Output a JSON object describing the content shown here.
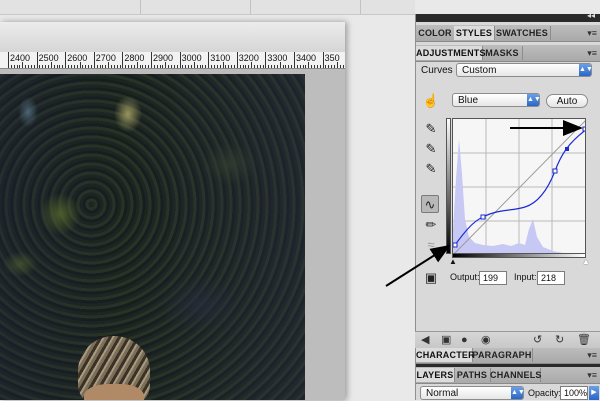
{
  "document": {
    "ruler_labels": [
      "2400",
      "2500",
      "2600",
      "2700",
      "2800",
      "2900",
      "3000",
      "3100",
      "3200",
      "3300",
      "3400",
      "350"
    ]
  },
  "panels": {
    "top_tabs": [
      "COLOR",
      "STYLES",
      "SWATCHES"
    ],
    "adjustment_tabs": [
      "ADJUSTMENTS",
      "MASKS"
    ],
    "curves_label": "Curves",
    "preset_value": "Custom",
    "channel_value": "Blue",
    "auto_label": "Auto",
    "output_label": "Output:",
    "output_value": "199",
    "input_label": "Input:",
    "input_value": "218",
    "character_tabs": [
      "CHARACTER",
      "PARAGRAPH"
    ],
    "layer_tabs": [
      "LAYERS",
      "PATHS",
      "CHANNELS"
    ],
    "blend_mode": "Normal",
    "opacity_label": "Opacity:",
    "opacity_value": "100%"
  },
  "icons": {
    "hand": "on-image-adjust-icon",
    "eyedropper_black": "eyedropper-black-icon",
    "eyedropper_gray": "eyedropper-gray-icon",
    "eyedropper_white": "eyedropper-white-icon",
    "curve_point": "curve-point-tool-icon",
    "pencil": "pencil-draw-icon",
    "smooth": "smooth-curve-icon",
    "clip": "clip-warning-icon"
  },
  "colors": {
    "curve": "#1a2bd6",
    "histogram": "#c8c8f4",
    "accent": "#2a66c6"
  }
}
